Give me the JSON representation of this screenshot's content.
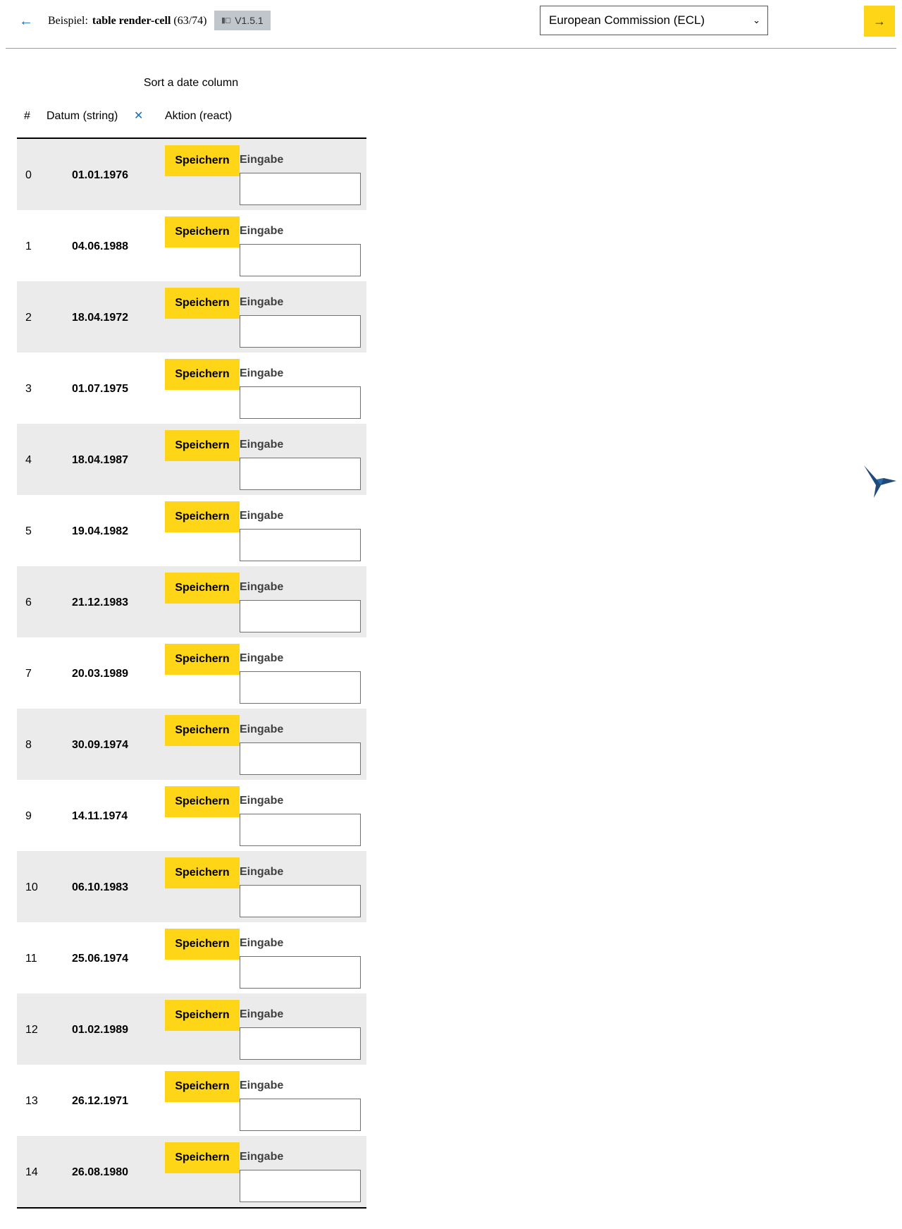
{
  "header": {
    "back_icon": "arrow-left-icon",
    "title_label": "Beispiel:",
    "title_name": "table render-cell",
    "title_count": "(63/74)",
    "version_icon": "book-icon",
    "version": "V1.5.1",
    "theme_select_value": "European Commission (ECL)",
    "next_icon": "arrow-right-icon"
  },
  "caption": "Sort a date column",
  "table": {
    "columns": {
      "index": "#",
      "date": "Datum (string)",
      "action": "Aktion (react)"
    },
    "sort_icon": "close-x-icon",
    "save_label": "Speichern",
    "input_label": "Eingabe",
    "rows": [
      {
        "index": "0",
        "date": "01.01.1976"
      },
      {
        "index": "1",
        "date": "04.06.1988"
      },
      {
        "index": "2",
        "date": "18.04.1972"
      },
      {
        "index": "3",
        "date": "01.07.1975"
      },
      {
        "index": "4",
        "date": "18.04.1987"
      },
      {
        "index": "5",
        "date": "19.04.1982"
      },
      {
        "index": "6",
        "date": "21.12.1983"
      },
      {
        "index": "7",
        "date": "20.03.1989"
      },
      {
        "index": "8",
        "date": "30.09.1974"
      },
      {
        "index": "9",
        "date": "14.11.1974"
      },
      {
        "index": "10",
        "date": "06.10.1983"
      },
      {
        "index": "11",
        "date": "25.06.1974"
      },
      {
        "index": "12",
        "date": "01.02.1989"
      },
      {
        "index": "13",
        "date": "26.12.1971"
      },
      {
        "index": "14",
        "date": "26.08.1980"
      }
    ]
  },
  "colors": {
    "accent": "#ffd617",
    "link": "#1a6fb3",
    "row_shade": "#ebebeb",
    "bird": "#1f4a7a"
  },
  "floating_icon": "hummingbird-icon"
}
